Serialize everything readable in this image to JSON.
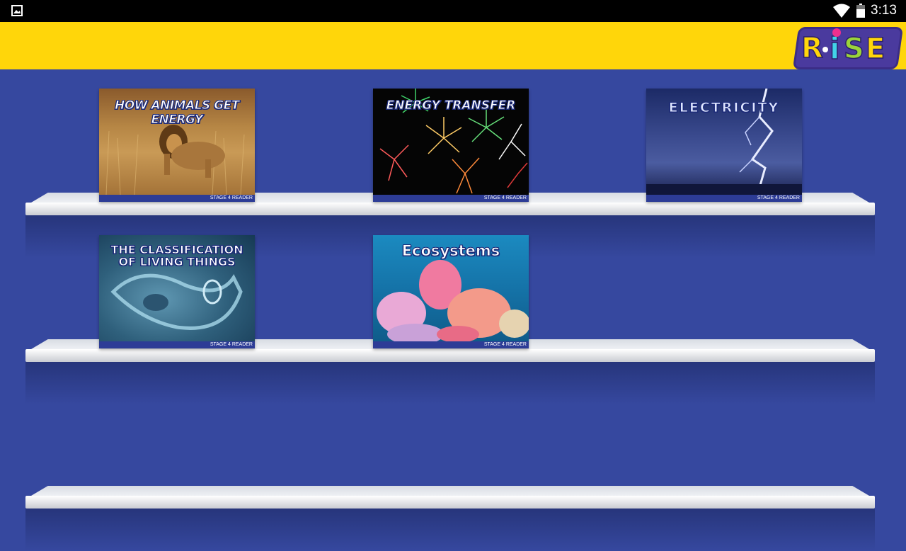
{
  "status_bar": {
    "time": "3:13",
    "icons": [
      "gallery-icon",
      "wifi-icon",
      "battery-icon"
    ]
  },
  "app_bar": {
    "logo_text": "R·iSE",
    "colors": {
      "background": "#ffd60a",
      "logo": "#4a3a9e"
    }
  },
  "library": {
    "background_color": "#36489f",
    "books": [
      {
        "title": "HOW ANIMALS GET ENERGY",
        "stage_label": "STAGE 4 READER"
      },
      {
        "title": "ENERGY TRANSFER",
        "stage_label": "STAGE 4 READER"
      },
      {
        "title": "ELECTRICITY",
        "stage_label": "STAGE 4 READER"
      },
      {
        "title": "THE CLASSIFICATION OF LIVING THINGS",
        "stage_label": "STAGE 4 READER"
      },
      {
        "title": "Ecosystems",
        "stage_label": "STAGE 4 READER"
      }
    ]
  }
}
